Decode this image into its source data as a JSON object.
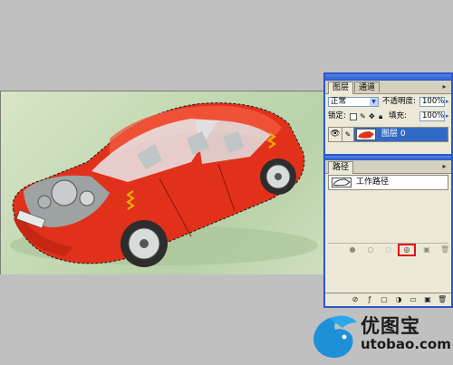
{
  "layers_panel": {
    "tabs": [
      "图层",
      "通道"
    ],
    "blend_mode": "正常",
    "opacity_label": "不透明度:",
    "opacity_value": "100%",
    "lock_label": "锁定:",
    "fill_label": "填充:",
    "fill_value": "100%",
    "layer_name": "图层 0"
  },
  "paths_panel": {
    "tab": "路径",
    "path_name": "工作路径"
  },
  "watermark": {
    "cn": "优图宝",
    "en": "utobao.com"
  },
  "colors": {
    "panel_border": "#2c57c9",
    "selection": "#316ac5",
    "highlight": "#e0101a",
    "car_red": "#e2311b"
  }
}
